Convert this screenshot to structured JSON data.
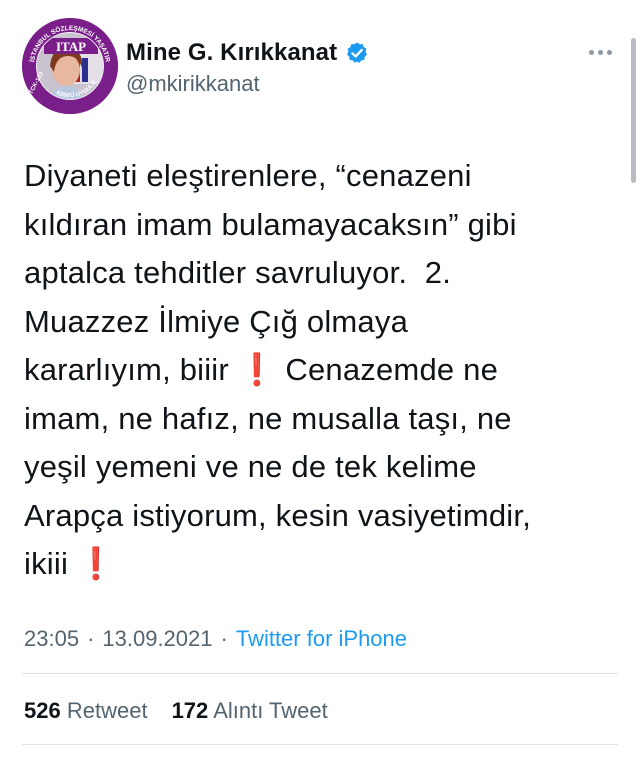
{
  "user": {
    "display_name": "Mine G. Kırıkkanat",
    "handle": "@mkirikkanat",
    "verified": true,
    "avatar_badge_text": "ITAP",
    "avatar_ring_text_top": "İSTANBUL SÖZLEŞMESİ YAŞATIR",
    "avatar_ring_text_bottom": "6284'Ü UYGULA",
    "avatar_ring_text_left": "TCK-103"
  },
  "tweet": {
    "lines": [
      {
        "text": "Diyaneti eleştirenlere, “cenazeni"
      },
      {
        "text": "kıldıran imam bulamayacaksın” gibi"
      },
      {
        "text": "aptalca tehditler savruluyor.  2."
      },
      {
        "text": "Muazzez İlmiye Çığ olmaya"
      },
      {
        "text": "kararlıyım, biiir",
        "emoji_after": "❗",
        "text_after": " Cenazemde ne"
      },
      {
        "text": "imam, ne hafız, ne musalla taşı, ne"
      },
      {
        "text": "yeşil yemeni ve ne de tek kelime"
      },
      {
        "text": "Arapça istiyorum, kesin vasiyetimdir,"
      },
      {
        "text": "ikiii",
        "emoji_after": "❗"
      }
    ]
  },
  "meta": {
    "time": "23:05",
    "separator": "·",
    "date": "13.09.2021",
    "source": "Twitter for iPhone"
  },
  "stats": {
    "retweets_count": "526",
    "retweets_label": "Retweet",
    "quotes_count": "172",
    "quotes_label": "Alıntı Tweet"
  },
  "icons": {
    "verified": "verified-badge-icon",
    "more": "more-options-icon"
  },
  "colors": {
    "accent": "#1d9bf0",
    "secondary_text": "#536471",
    "exclamation": "#e0211c",
    "avatar_ring": "#7a1f8a"
  }
}
